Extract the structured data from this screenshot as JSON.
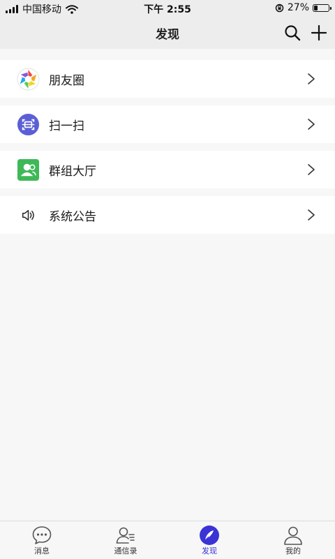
{
  "status_bar": {
    "carrier": "中国移动",
    "time": "下午 2:55",
    "battery_percent": "27%",
    "battery_level": 0.27
  },
  "header": {
    "title": "发现",
    "search_icon": "search-icon",
    "add_icon": "plus-icon"
  },
  "menu": {
    "items": [
      {
        "label": "朋友圈",
        "icon": "moments-aperture-icon"
      },
      {
        "label": "扫一扫",
        "icon": "scan-icon"
      },
      {
        "label": "群组大厅",
        "icon": "group-hall-icon"
      },
      {
        "label": "系统公告",
        "icon": "speaker-icon"
      }
    ]
  },
  "tab_bar": {
    "tabs": [
      {
        "label": "消息",
        "icon": "chat-bubble-icon"
      },
      {
        "label": "通信录",
        "icon": "contacts-icon"
      },
      {
        "label": "发现",
        "icon": "compass-icon",
        "active": true
      },
      {
        "label": "我的",
        "icon": "profile-icon"
      }
    ]
  },
  "colors": {
    "accent": "#3a33d6",
    "scan_bg": "#5b5fd6",
    "group_bg": "#3fb858"
  }
}
